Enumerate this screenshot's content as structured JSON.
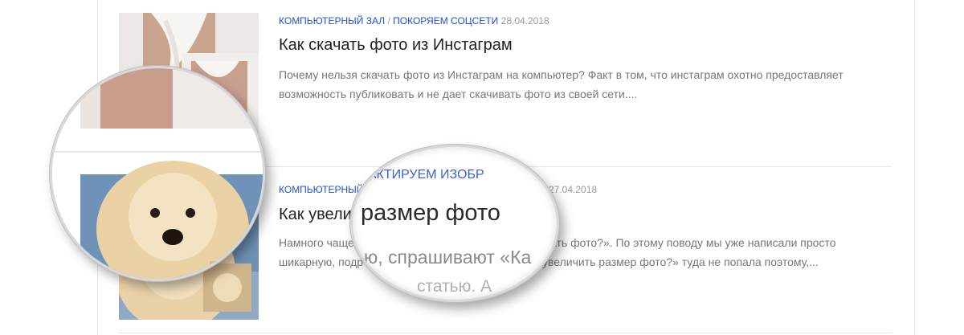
{
  "articles": [
    {
      "category1": "Компьютерный зал",
      "separator": "/",
      "category2": "Покоряем соцсети",
      "date": "28.04.2018",
      "title": "Как скачать фото из Инстаграм",
      "excerpt": "Почему нельзя скачать фото из Инстаграм на компьютер? Факт в том, что инстаграм охотно предоставляет возможность публиковать и не дает скачивать фото из своей сети...."
    },
    {
      "category1": "Компьютерный",
      "date": "27.04.2018",
      "title_left": "Как увели",
      "excerpt_line1_left": "Намного чаще",
      "excerpt_line1_right": "ать фото?». По этому поводу мы уже написали просто",
      "excerpt_line2_left": "шикарную, подр",
      "excerpt_line2_right": "увеличить размер фото?» туда не попала поэтому,..."
    }
  ],
  "magnifier": {
    "cat_text": "ДАКТИРУЕМ ИЗОБР",
    "title_text": "размер фото",
    "excerpt_text": "ю, спрашивают «Ка",
    "excerpt_text2": "статью. А"
  },
  "colors": {
    "link": "#1f4fd1",
    "meta_gray": "#999999",
    "title": "#222222",
    "excerpt": "#777777"
  }
}
